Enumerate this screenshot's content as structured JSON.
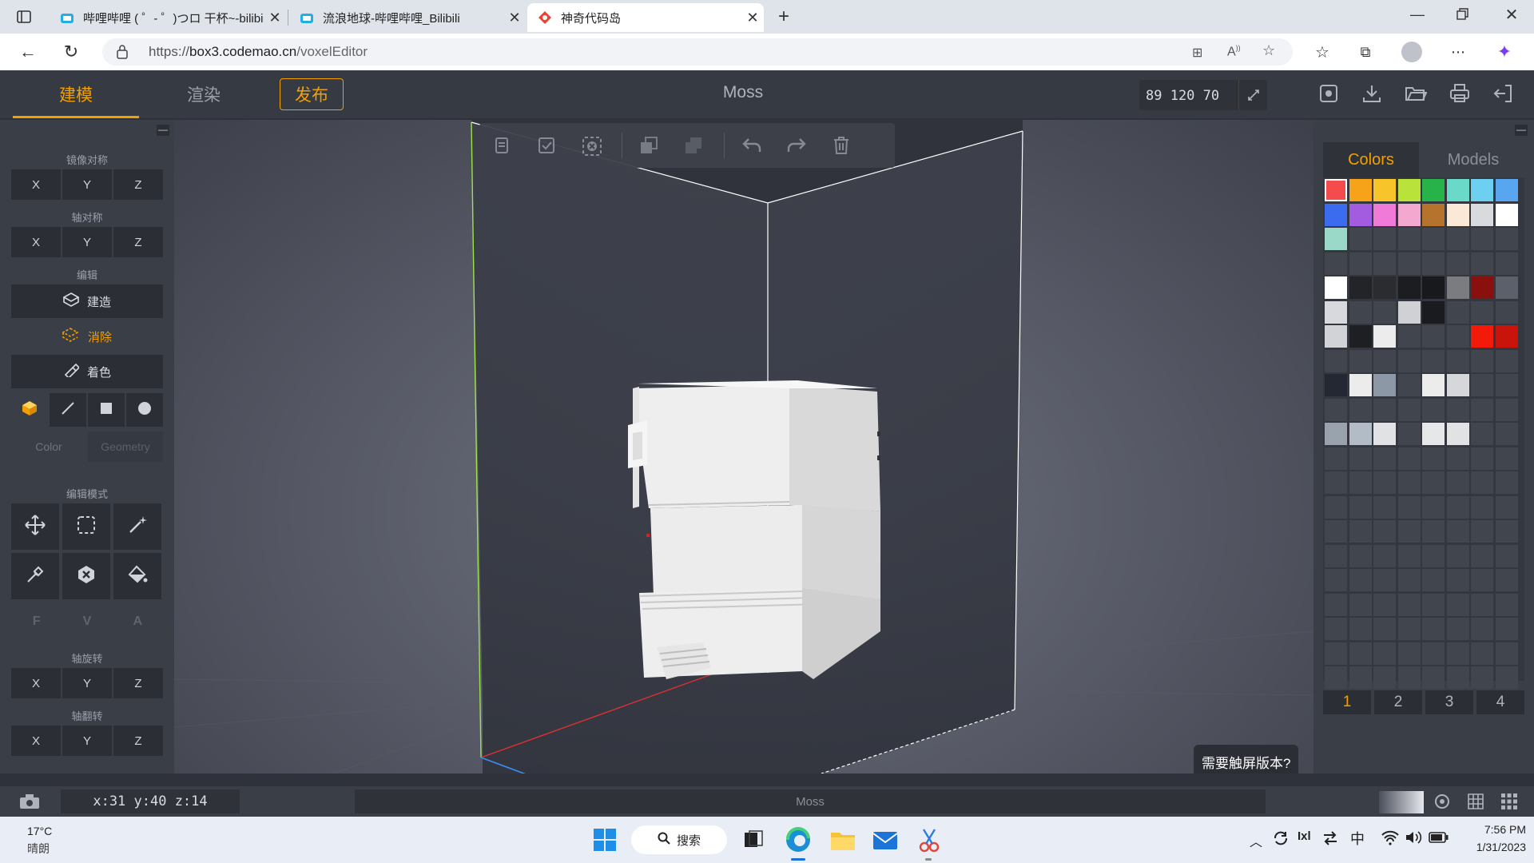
{
  "browser": {
    "tabs": [
      {
        "title": "哔哩哔哩 ( ゜- ゜)つロ 干杯~-bilibili"
      },
      {
        "title": "流浪地球-哔哩哔哩_Bilibili"
      },
      {
        "title": "神奇代码岛"
      }
    ],
    "url_prefix": "https://",
    "url_host": "box3.codemao.cn",
    "url_path": "/voxelEditor",
    "accent": "#f2a000"
  },
  "header": {
    "tabs": [
      {
        "label": "建模",
        "active": true
      },
      {
        "label": "渲染",
        "active": false
      }
    ],
    "publish_label": "发布",
    "project_name": "Moss",
    "dimensions": "89 120 70"
  },
  "left_panel": {
    "mirror": {
      "title": "镜像对称",
      "axes": [
        "X",
        "Y",
        "Z"
      ]
    },
    "axis_sym": {
      "title": "轴对称",
      "axes": [
        "X",
        "Y",
        "Z"
      ]
    },
    "edit": {
      "title": "编辑",
      "build": "建造",
      "erase": "消除",
      "paint": "着色"
    },
    "brush_tabs": [
      "Color",
      "Geometry"
    ],
    "edit_mode": {
      "title": "编辑模式",
      "fva": [
        "F",
        "V",
        "A"
      ]
    },
    "rotate": {
      "title": "轴旋转",
      "axes": [
        "X",
        "Y",
        "Z"
      ]
    },
    "flip": {
      "title": "轴翻转",
      "axes": [
        "X",
        "Y",
        "Z"
      ]
    }
  },
  "right_panel": {
    "tabs": [
      "Colors",
      "Models"
    ],
    "pages": [
      "1",
      "2",
      "3",
      "4"
    ],
    "palette": [
      "#f44c4c",
      "#f6a31a",
      "#f7c52a",
      "#b9e23a",
      "#27b24a",
      "#6ad9c8",
      "#6ed0f0",
      "#58a6f0",
      "#3b6cf0",
      "#a35be0",
      "#f07ad8",
      "#f3a9cf",
      "#b5732e",
      "#fbe8d6",
      "#d9dadd",
      "#ffffff",
      "#9ad8c8"
    ],
    "grid2": [
      [
        "#ffffff",
        "#222428",
        "#2a2c30",
        "#1c1d20",
        "#18191c",
        "#7a7c80",
        "#8a1010",
        "#5c606a"
      ],
      [
        "#d8d9dc",
        null,
        null,
        "#d0d1d4",
        "#1a1b1e",
        null,
        null,
        null
      ],
      [
        "#d2d3d6",
        "#1e1f22",
        "#ececec",
        null,
        null,
        null,
        "#f31a0a",
        "#c8140a"
      ],
      [
        null,
        null,
        null,
        null,
        null,
        null,
        null,
        null
      ],
      [
        "#232833",
        "#ececec",
        "#8d98a6",
        null,
        "#ececec",
        "#d6d7da",
        null,
        null
      ],
      [
        null,
        null,
        null,
        null,
        null,
        null,
        null,
        null
      ],
      [
        "#9aa2ae",
        "#b3bcc6",
        "#e1e2e4",
        null,
        "#e6e7e9",
        "#e1e2e4",
        null,
        null
      ]
    ]
  },
  "viewport": {
    "toolbar_icons": [
      "copy-icon",
      "paste-icon",
      "delete-selection-icon",
      "duplicate-icon",
      "merge-icon",
      "undo-icon",
      "redo-icon",
      "trash-icon"
    ],
    "hint": "需要触屏版本?"
  },
  "status": {
    "coords": "x:31 y:40 z:14",
    "model": "Moss"
  },
  "taskbar": {
    "temp": "17°C",
    "weather": "晴朗",
    "search": "搜索",
    "ime": "中",
    "time": "7:56 PM",
    "date": "1/31/2023"
  }
}
